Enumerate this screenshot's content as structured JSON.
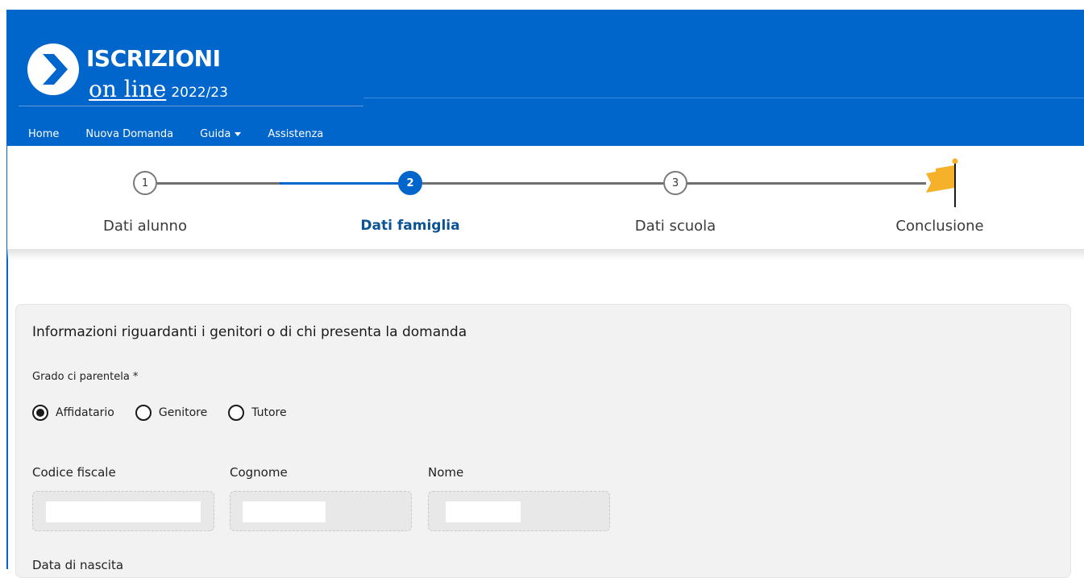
{
  "header": {
    "brand_title": "ISCRIZIONI",
    "brand_subtitle": "on line",
    "brand_year": "2022/23",
    "background_color": "#0066cc",
    "logo_icon": "chevron-right-circle-icon"
  },
  "nav": {
    "items": [
      {
        "label": "Home"
      },
      {
        "label": "Nuova Domanda"
      },
      {
        "label": "Guida",
        "has_dropdown": true
      },
      {
        "label": "Assistenza"
      }
    ]
  },
  "stepper": {
    "steps": [
      {
        "number": "1",
        "label": "Dati alunno",
        "state": "completed"
      },
      {
        "number": "2",
        "label": "Dati famiglia",
        "state": "active"
      },
      {
        "number": "3",
        "label": "Dati scuola",
        "state": "pending"
      },
      {
        "label": "Conclusione",
        "icon": "flag-icon",
        "state": "pending"
      }
    ],
    "active_color": "#0066cc",
    "flag_color": "#f6b12a"
  },
  "form": {
    "section_title": "Informazioni riguardanti i genitori o di chi presenta la domanda",
    "relationship_label": "Grado ci parentela *",
    "relationship_options": [
      {
        "label": "Affidatario",
        "selected": true
      },
      {
        "label": "Genitore",
        "selected": false
      },
      {
        "label": "Tutore",
        "selected": false
      }
    ],
    "fields": [
      {
        "label": "Codice fiscale",
        "value": ""
      },
      {
        "label": "Cognome",
        "value": ""
      },
      {
        "label": "Nome",
        "value": ""
      }
    ],
    "birth_date_label": "Data di nascita"
  }
}
